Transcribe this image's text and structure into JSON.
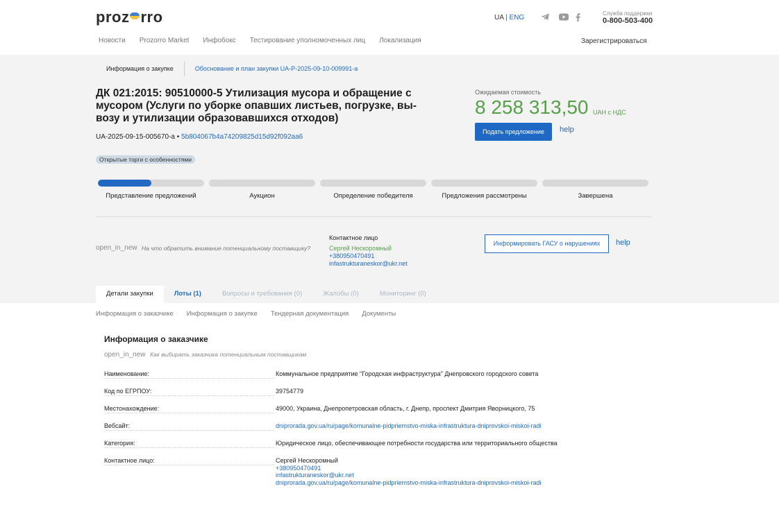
{
  "header": {
    "logo": {
      "pre": "proz",
      "post": "rro"
    },
    "lang": {
      "ua": "UA",
      "sep": "|",
      "eng": "ENG"
    },
    "social": [
      "telegram-icon",
      "youtube-icon",
      "facebook-icon"
    ],
    "support_label": "Служба поддержки",
    "support_phone": "0-800-503-400",
    "nav": [
      "Новости",
      "Prozorro Market",
      "Инфобокс",
      "Тестирование уполномоченных лиц",
      "Локализация"
    ],
    "register": "Зарегистрироваться"
  },
  "breadcrumbs": {
    "current": "Информация о закупке",
    "link": "Обоснование и план закупки UA-P-2025-09-10-009991-a"
  },
  "tender": {
    "title": "ДК 021:2015: 90510000-5 Утилизация мусора и обращение с мусором (Услуги по уборке опавших листьев, погрузке, вы­возу и утилизации образовавшихся отходов)",
    "id": "UA-2025-09-15-005670-a",
    "bullet": "•",
    "hash": "5b804067b4a74209825d15d92f092aa6",
    "badge": "Открытые торги с особенностями"
  },
  "expected": {
    "label": "Ожидаемая стоимость",
    "value": "8 258 313,50",
    "unit": "UAH с НДС",
    "offer_button": "Подать предложение",
    "help": "help"
  },
  "steps": [
    {
      "label": "Представление предложений",
      "progress": 0.5
    },
    {
      "label": "Аукцион",
      "progress": 0
    },
    {
      "label": "Определение победителя",
      "progress": 0
    },
    {
      "label": "Предложения рассмотрены",
      "progress": 0
    },
    {
      "label": "Завершена",
      "progress": 0
    }
  ],
  "attention": {
    "icon_text": "open_in_new",
    "text": "На что обратить внимание потенциальному поставщику?"
  },
  "contact": {
    "title": "Контактное лицо",
    "name": "Сергей Нескоромный",
    "phone": "+380950470491",
    "email": "infastrukturaneskor@ukr.net"
  },
  "inform_button": "Информировать ГАСУ о нарушениях",
  "help2": "help",
  "tabs": [
    "Детали закупки",
    "Лоты (1)",
    "Вопросы и требования (0)",
    "Жалобы (0)",
    "Мониторинг (0)"
  ],
  "subtabs": [
    "Информация о заказчике",
    "Информация о закупке",
    "Тендерная документация",
    "Документы"
  ],
  "customer": {
    "title": "Информация о заказчике",
    "hint_icon": "open_in_new",
    "hint": "Как выбирать заказчика потенциальным поставщикам",
    "rows": [
      {
        "key": "Наименование:",
        "value": "Коммунальное предприятие \"Городская инфраструктура\" Днепровского городского совета"
      },
      {
        "key": "Код по ЕГРПОУ:",
        "value": "39754779"
      },
      {
        "key": "Местонахождение:",
        "value": "49000, Украина, Днепропетровская область, г. Днепр, проспект Дмитрия Яворницкого, 75"
      },
      {
        "key": "Вебсайт:",
        "value": "dniprorada.gov.ua/ru/page/komunalne-pidpriemstvo-miska-infrastruktura-dniprovskoi-miskoi-radi"
      },
      {
        "key": "Категория:",
        "value": "Юридическое лицо, обеспечивающее потребности государства или территориального общества"
      },
      {
        "key": "Контактное лицо:",
        "name": "Сергей Нескоромный",
        "phone": "+380950470491",
        "email": "infastrukturaneskor@ukr.net",
        "site": "dniprorada.gov.ua/ru/page/komunalne-pidpriemstvo-miska-infrastruktura-dniprovskoi-miskoi-radi"
      }
    ]
  }
}
